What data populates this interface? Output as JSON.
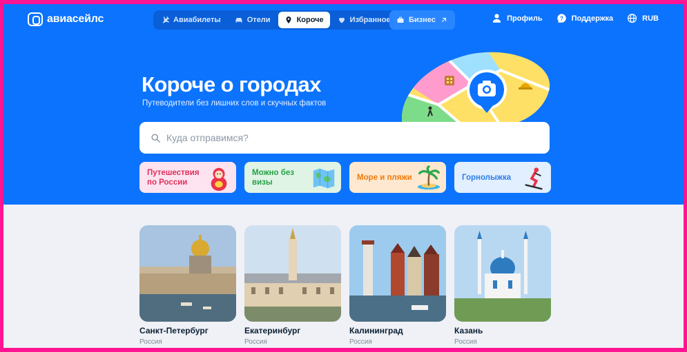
{
  "logo": {
    "text": "авиасейлс"
  },
  "nav": {
    "tabs": [
      {
        "label": "Авиабилеты",
        "icon": "plane-icon",
        "active": false
      },
      {
        "label": "Отели",
        "icon": "bed-icon",
        "active": false
      },
      {
        "label": "Короче",
        "icon": "pin-icon",
        "active": true
      },
      {
        "label": "Избранное",
        "icon": "heart-icon",
        "active": false
      }
    ],
    "business": {
      "label": "Бизнес",
      "icon": "briefcase-icon"
    },
    "profile": "Профиль",
    "support": "Поддержка",
    "currency": "RUB"
  },
  "hero": {
    "title": "Короче о городах",
    "subtitle": "Путеводители без лишних слов и скучных фактов",
    "search_placeholder": "Куда отправимся?"
  },
  "categories": [
    {
      "label": "Путешествия по России",
      "color": "#e0305c"
    },
    {
      "label": "Можно без визы",
      "color": "#27a146"
    },
    {
      "label": "Море и пляжи",
      "color": "#f07a0c"
    },
    {
      "label": "Горнолыжка",
      "color": "#2c7ee8"
    }
  ],
  "cities": [
    {
      "name": "Санкт-Петербург",
      "country": "Россия"
    },
    {
      "name": "Екатеринбург",
      "country": "Россия"
    },
    {
      "name": "Калининград",
      "country": "Россия"
    },
    {
      "name": "Казань",
      "country": "Россия"
    }
  ],
  "colors": {
    "hero_bg": "#0c73fe",
    "page_bg": "#eff1f6",
    "frame": "#ff1493"
  }
}
